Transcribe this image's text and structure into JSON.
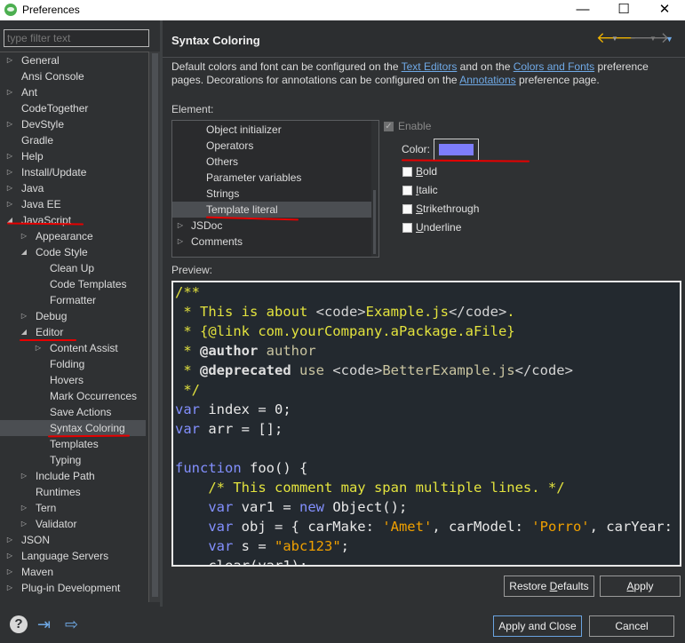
{
  "window": {
    "title": "Preferences",
    "minimize": "—",
    "maximize": "☐",
    "close": "✕"
  },
  "filter": {
    "placeholder": "type filter text"
  },
  "tree": [
    {
      "label": "General",
      "indent": 0,
      "expander": "collapsed"
    },
    {
      "label": "Ansi Console",
      "indent": 0,
      "expander": "none"
    },
    {
      "label": "Ant",
      "indent": 0,
      "expander": "collapsed"
    },
    {
      "label": "CodeTogether",
      "indent": 0,
      "expander": "none"
    },
    {
      "label": "DevStyle",
      "indent": 0,
      "expander": "collapsed"
    },
    {
      "label": "Gradle",
      "indent": 0,
      "expander": "none"
    },
    {
      "label": "Help",
      "indent": 0,
      "expander": "collapsed"
    },
    {
      "label": "Install/Update",
      "indent": 0,
      "expander": "collapsed"
    },
    {
      "label": "Java",
      "indent": 0,
      "expander": "collapsed"
    },
    {
      "label": "Java EE",
      "indent": 0,
      "expander": "collapsed"
    },
    {
      "label": "JavaScript",
      "indent": 0,
      "expander": "expanded"
    },
    {
      "label": "Appearance",
      "indent": 1,
      "expander": "collapsed"
    },
    {
      "label": "Code Style",
      "indent": 1,
      "expander": "expanded"
    },
    {
      "label": "Clean Up",
      "indent": 2,
      "expander": "none"
    },
    {
      "label": "Code Templates",
      "indent": 2,
      "expander": "none"
    },
    {
      "label": "Formatter",
      "indent": 2,
      "expander": "none"
    },
    {
      "label": "Debug",
      "indent": 1,
      "expander": "collapsed"
    },
    {
      "label": "Editor",
      "indent": 1,
      "expander": "expanded"
    },
    {
      "label": "Content Assist",
      "indent": 2,
      "expander": "collapsed"
    },
    {
      "label": "Folding",
      "indent": 2,
      "expander": "none"
    },
    {
      "label": "Hovers",
      "indent": 2,
      "expander": "none"
    },
    {
      "label": "Mark Occurrences",
      "indent": 2,
      "expander": "none"
    },
    {
      "label": "Save Actions",
      "indent": 2,
      "expander": "none"
    },
    {
      "label": "Syntax Coloring",
      "indent": 2,
      "expander": "none",
      "selected": true
    },
    {
      "label": "Templates",
      "indent": 2,
      "expander": "none"
    },
    {
      "label": "Typing",
      "indent": 2,
      "expander": "none"
    },
    {
      "label": "Include Path",
      "indent": 1,
      "expander": "collapsed"
    },
    {
      "label": "Runtimes",
      "indent": 1,
      "expander": "none"
    },
    {
      "label": "Tern",
      "indent": 1,
      "expander": "collapsed"
    },
    {
      "label": "Validator",
      "indent": 1,
      "expander": "collapsed"
    },
    {
      "label": "JSON",
      "indent": 0,
      "expander": "collapsed"
    },
    {
      "label": "Language Servers",
      "indent": 0,
      "expander": "collapsed"
    },
    {
      "label": "Maven",
      "indent": 0,
      "expander": "collapsed"
    },
    {
      "label": "Plug-in Development",
      "indent": 0,
      "expander": "collapsed"
    }
  ],
  "page": {
    "title": "Syntax Coloring",
    "desc_1": "Default colors and font can be configured on the ",
    "link_text_editors": "Text Editors",
    "desc_2": " and on the ",
    "link_colors_fonts": "Colors and Fonts",
    "desc_3": " preference pages.  Decorations for annotations can be configured on the ",
    "link_annotations": "Annotations",
    "desc_4": " preference page.",
    "element_label": "Element:",
    "preview_label": "Preview:"
  },
  "elements": [
    {
      "label": "Object initializer",
      "indent": 1,
      "expander": "none"
    },
    {
      "label": "Operators",
      "indent": 1,
      "expander": "none"
    },
    {
      "label": "Others",
      "indent": 1,
      "expander": "none"
    },
    {
      "label": "Parameter variables",
      "indent": 1,
      "expander": "none"
    },
    {
      "label": "Strings",
      "indent": 1,
      "expander": "none"
    },
    {
      "label": "Template literal",
      "indent": 1,
      "expander": "none",
      "selected": true
    },
    {
      "label": "JSDoc",
      "indent": 0,
      "expander": "collapsed"
    },
    {
      "label": "Comments",
      "indent": 0,
      "expander": "collapsed"
    }
  ],
  "options": {
    "enable": {
      "label": "Enable",
      "checked": true,
      "disabled": true
    },
    "color_label": "Color:",
    "color_value": "#7d7dfc",
    "bold": {
      "label": "Bold",
      "mnemonic": "B",
      "rest": "old",
      "checked": false
    },
    "italic": {
      "label": "Italic",
      "mnemonic": "I",
      "rest": "talic",
      "checked": false
    },
    "strikethrough": {
      "label": "Strikethrough",
      "mnemonic": "S",
      "rest": "trikethrough",
      "checked": false
    },
    "underline": {
      "label": "Underline",
      "mnemonic": "U",
      "rest": "nderline",
      "checked": false
    }
  },
  "buttons": {
    "restore_defaults_pre": "Restore ",
    "restore_defaults_mn": "D",
    "restore_defaults_post": "efaults",
    "apply_mn": "A",
    "apply_post": "pply",
    "apply_close": "Apply and Close",
    "cancel": "Cancel"
  },
  "icons": {
    "nav_back": "back-arrow-icon",
    "nav_forward": "forward-arrow-icon",
    "help": "help-icon",
    "import": "import-icon",
    "export": "export-icon"
  },
  "colors": {
    "comment": "#e3e33e",
    "keyword": "#8390ff",
    "string": "#f0a000",
    "annotation_mark": "#e60000"
  }
}
